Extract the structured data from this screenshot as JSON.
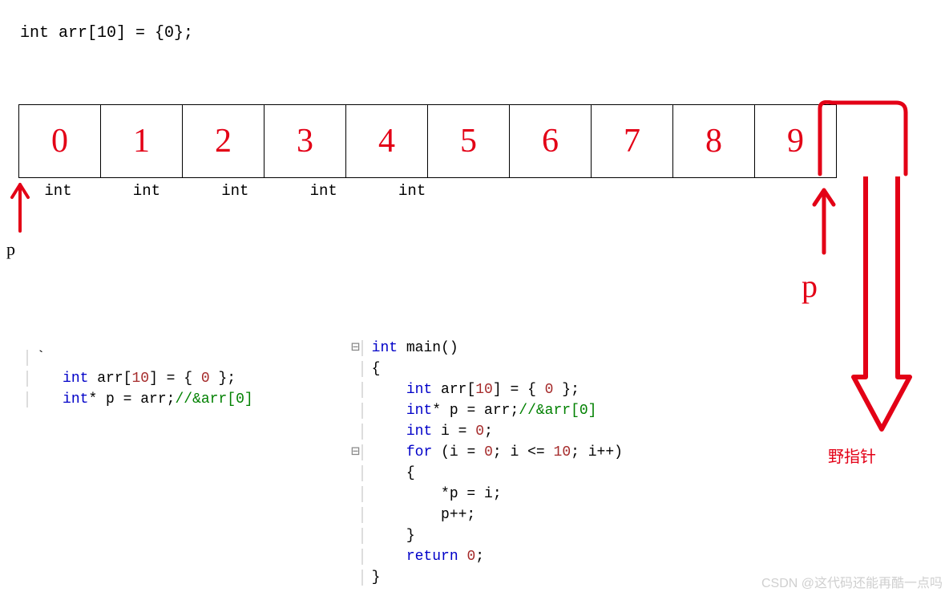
{
  "decl": "int arr[10] = {0};",
  "array": {
    "indices": [
      "0",
      "1",
      "2",
      "3",
      "4",
      "5",
      "6",
      "7",
      "8",
      "9"
    ],
    "type_labels": [
      "int",
      "int",
      "int",
      "int",
      "int"
    ]
  },
  "pointer_start": "p",
  "pointer_end": "p",
  "wild_label": "野指针",
  "watermark": "CSDN @这代码还能再酷一点吗",
  "code1": {
    "tick": "`",
    "l1_kw": "int",
    "l1_rest": " arr[",
    "l1_num": "10",
    "l1_rest2": "] = { ",
    "l1_zero": "0",
    "l1_rest3": " };",
    "l2_kw": "int",
    "l2_rest": "* p = arr;",
    "l2_cm": "//&arr[0]"
  },
  "code2": {
    "box1": "⊟",
    "box2": "⊟",
    "l1_kw": "int",
    "l1_rest": " main()",
    "l2": "{",
    "l3_kw": "int",
    "l3_a": " arr[",
    "l3_n": "10",
    "l3_b": "] = { ",
    "l3_z": "0",
    "l3_c": " };",
    "l4_kw": "int",
    "l4_a": "* p = arr;",
    "l4_cm": "//&arr[0]",
    "l5_kw": "int",
    "l5_a": " i = ",
    "l5_n": "0",
    "l5_b": ";",
    "l6_kw": "for",
    "l6_a": " (i = ",
    "l6_n0": "0",
    "l6_b": "; i <= ",
    "l6_n1": "10",
    "l6_c": "; i++)",
    "l7": "{",
    "l8": "*p = i;",
    "l9": "p++;",
    "l10": "}",
    "l11_kw": "return",
    "l11_a": " ",
    "l11_n": "0",
    "l11_b": ";",
    "l12": "}"
  },
  "chart_data": {
    "type": "table",
    "title": "C array memory layout with wild-pointer illustration",
    "cells": [
      0,
      1,
      2,
      3,
      4,
      5,
      6,
      7,
      8,
      9
    ],
    "element_type": "int",
    "pointer_initial_index": 0,
    "pointer_final_index": 10,
    "wild_pointer": true,
    "loop_condition": "i <= 10"
  }
}
